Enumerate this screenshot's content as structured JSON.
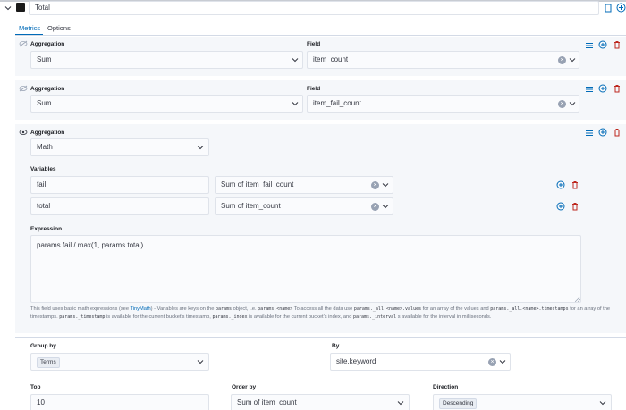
{
  "series": {
    "label": "Total",
    "color": "#1a1a1a"
  },
  "tabs": [
    {
      "label": "Metrics",
      "active": true
    },
    {
      "label": "Options",
      "active": false
    }
  ],
  "metrics": [
    {
      "aggregation_label": "Aggregation",
      "aggregation": "Sum",
      "field_label": "Field",
      "field": "item_count"
    },
    {
      "aggregation_label": "Aggregation",
      "aggregation": "Sum",
      "field_label": "Field",
      "field": "item_fail_count"
    }
  ],
  "math": {
    "aggregation_label": "Aggregation",
    "aggregation": "Math",
    "variables_label": "Variables",
    "variables": [
      {
        "name": "fail",
        "metric": "Sum of item_fail_count"
      },
      {
        "name": "total",
        "metric": "Sum of item_count"
      }
    ],
    "expression_label": "Expression",
    "expression": "params.fail / max(1, params.total)",
    "help": {
      "t1": "This field uses basic math expressions (see ",
      "link": "TinyMath",
      "t2": ") - Variables are keys on the",
      "c1": "params",
      "t3": "object, i.e.",
      "c2": "params.<name>",
      "t4": "To access all the data use",
      "c3": "params._all.<name>.values",
      "t5": "for an array of the values and",
      "c4": "params._all.<name>.timestamps",
      "t6": "for an array of the timestamps.",
      "c5": "params._timestamp",
      "t7": "is available for the current bucket's timestamp,",
      "c6": "params._index",
      "t8": "is available for the current bucket's index, and",
      "c7": "params._interval",
      "t9": "s available for the interval in milliseconds."
    }
  },
  "group": {
    "group_by_label": "Group by",
    "group_by": "Terms",
    "by_label": "By",
    "by": "site.keyword",
    "top_label": "Top",
    "top": "10",
    "order_by_label": "Order by",
    "order_by": "Sum of item_count",
    "direction_label": "Direction",
    "direction": "Descending"
  },
  "colors": {
    "accent": "#006bb8",
    "danger": "#bd271e",
    "panel": "#f5f7fa"
  }
}
